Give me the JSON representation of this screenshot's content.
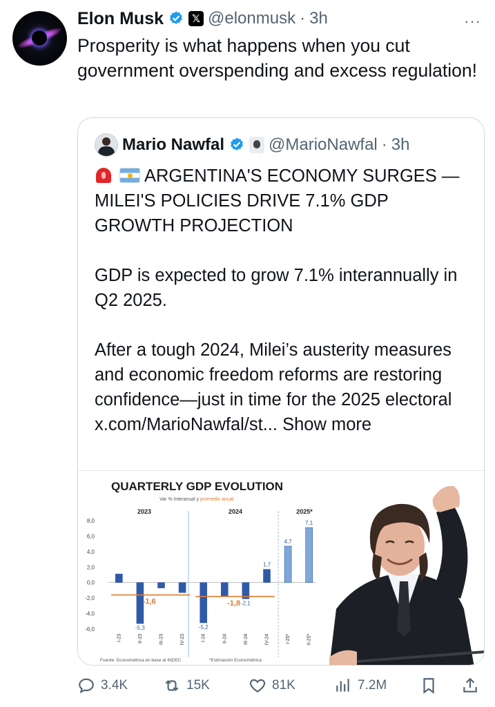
{
  "tweet": {
    "author_name": "Elon Musk",
    "handle": "@elonmusk",
    "time": "3h",
    "separator": "·",
    "more_label": "···",
    "text": "Prosperity is what happens when you cut government overspending and excess regulation!",
    "x_badge": "𝕏"
  },
  "quote": {
    "author_name": "Mario Nawfal",
    "handle": "@MarioNawfal",
    "time": "3h",
    "separator": "·",
    "headline": "ARGENTINA'S ECONOMY SURGES —MILEI'S POLICIES DRIVE 7.1% GDP GROWTH PROJECTION",
    "para1": "GDP is expected to grow 7.1% interannually in Q2 2025.",
    "para2_text": "After a tough 2024, Milei’s austerity measures and economic freedom reforms are restoring confidence—just in time for the 2025 electoral ",
    "para2_link": "x.com/MarioNawfal/st...",
    "show_more": "Show more"
  },
  "chart_data": {
    "type": "bar",
    "title": "QUARTERLY GDP EVOLUTION",
    "subtitle_part1": "Var % Interanual y ",
    "subtitle_part2": "promedio anual",
    "year_labels": [
      "2023",
      "2024",
      "2025*"
    ],
    "categories": [
      "I-23",
      "II-23",
      "III-23",
      "IV-23",
      "I-24",
      "II-24",
      "III-24",
      "IV-24",
      "I-25*",
      "II-25*"
    ],
    "values": [
      1.1,
      -5.3,
      -0.7,
      -1.3,
      -5.2,
      -1.8,
      -2.1,
      1.7,
      4.7,
      7.1
    ],
    "value_labels": [
      "",
      "-5,3",
      "",
      "",
      "-5,2",
      "",
      "-2,1",
      "1,7",
      "4,7",
      "7,1"
    ],
    "averages": [
      {
        "label": "-1,6",
        "value": -1.6
      },
      {
        "label": "-1,8",
        "value": -1.8
      }
    ],
    "y_ticks": [
      "8,0",
      "6,0",
      "4,0",
      "2,0",
      "0,0",
      "-2,0",
      "-4,0",
      "-6,0"
    ],
    "ylim": [
      -6,
      8
    ],
    "footnote_source": "Fuente: Econométrica en base al INDEC",
    "footnote_estimate": "*Estimación Econométrica",
    "colors": {
      "bar": "#2f5aa8",
      "estimate_bar": "#7fa8d9",
      "average": "#e07a2e",
      "title": "#1b1b1b"
    }
  },
  "actions": {
    "replies": "3.4K",
    "reposts": "15K",
    "likes": "81K",
    "views": "7.2M"
  },
  "colors": {
    "verified": "#1d9bf0",
    "secondary_text": "#536471",
    "border": "#cfd9de"
  }
}
